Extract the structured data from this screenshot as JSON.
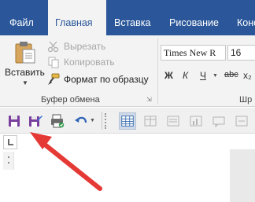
{
  "tabs": [
    {
      "label": "Файл"
    },
    {
      "label": "Главная"
    },
    {
      "label": "Вставка"
    },
    {
      "label": "Рисование"
    },
    {
      "label": "Конс"
    }
  ],
  "clipboard": {
    "paste_label": "Вставить",
    "cut_label": "Вырезать",
    "copy_label": "Копировать",
    "format_painter_label": "Формат по образцу",
    "group_label": "Буфер обмена"
  },
  "font": {
    "name": "Times New R",
    "size": "16",
    "bold": "Ж",
    "italic": "К",
    "underline": "Ч",
    "strike": "abc",
    "subscript": "x₂",
    "group_label": "Шр"
  },
  "colors": {
    "tab_bar": "#2b579a",
    "ribbon_bg": "#f3f3f3",
    "arrow": "#e53935"
  }
}
